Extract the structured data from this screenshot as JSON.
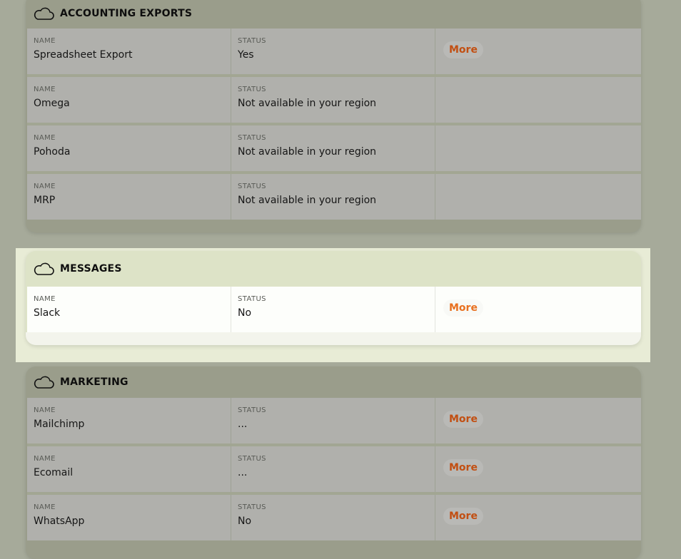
{
  "labels": {
    "name": "NAME",
    "status": "STATUS",
    "more": "More"
  },
  "sections": [
    {
      "title": "ACCOUNTING EXPORTS",
      "icon": "cloud-icon",
      "rows": [
        {
          "name": "Spreadsheet Export",
          "status": "Yes",
          "has_more": true
        },
        {
          "name": "Omega",
          "status": "Not available in your region",
          "has_more": false
        },
        {
          "name": "Pohoda",
          "status": "Not available in your region",
          "has_more": false
        },
        {
          "name": "MRP",
          "status": "Not available in your region",
          "has_more": false
        }
      ]
    },
    {
      "title": "MESSAGES",
      "icon": "cloud-icon",
      "rows": [
        {
          "name": "Slack",
          "status": "No",
          "has_more": true
        }
      ]
    },
    {
      "title": "MARKETING",
      "icon": "cloud-icon",
      "rows": [
        {
          "name": "Mailchimp",
          "status": "...",
          "has_more": true
        },
        {
          "name": "Ecomail",
          "status": "...",
          "has_more": true
        },
        {
          "name": "WhatsApp",
          "status": "No",
          "has_more": true
        }
      ]
    }
  ],
  "colors": {
    "accent": "#c24f12",
    "background": "#a6aa9a",
    "highlight": "#e8ecd6"
  }
}
